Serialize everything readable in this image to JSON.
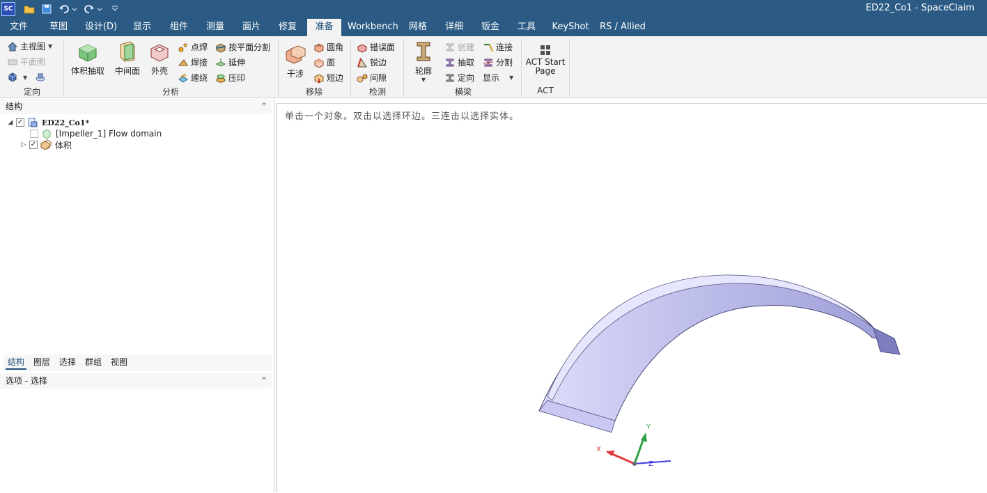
{
  "title_bar": {
    "app_badge": "SC",
    "window_title": "ED22_Co1 - SpaceClaim"
  },
  "tabs": [
    {
      "label": "文件"
    },
    {
      "label": "草图"
    },
    {
      "label": "设计(D)"
    },
    {
      "label": "显示"
    },
    {
      "label": "组件"
    },
    {
      "label": "测量"
    },
    {
      "label": "面片"
    },
    {
      "label": "修复"
    },
    {
      "label": "准备"
    },
    {
      "label": "Workbench"
    },
    {
      "label": "网格"
    },
    {
      "label": "详细"
    },
    {
      "label": "钣金"
    },
    {
      "label": "工具"
    },
    {
      "label": "KeyShot"
    },
    {
      "label": "RS / Allied"
    }
  ],
  "active_tab": "准备",
  "ribbon": {
    "orient": {
      "label": "定向",
      "home_view": "主视图",
      "plane_view": "平面图"
    },
    "analysis": {
      "label": "分析",
      "volume_extract": "体积抽取",
      "midsurface": "中间面",
      "shell": "外壳",
      "spot_weld": "点焊",
      "weld": "焊接",
      "wrap": "缠绕",
      "split_by_plane": "按平面分割",
      "extend": "延伸",
      "imprint": "压印"
    },
    "remove": {
      "label": "移除",
      "interference": "干涉",
      "rounds": "圆角",
      "faces": "面",
      "short_edges": "短边"
    },
    "detect": {
      "label": "检测",
      "problem_faces": "错误面",
      "sharp_edges": "锐边",
      "gaps": "间隙"
    },
    "beams": {
      "label": "横梁",
      "profile": "轮廓",
      "create": "创建",
      "extract": "抽取",
      "orient": "定向",
      "connect": "连接",
      "split": "分割",
      "display": "显示"
    },
    "act": {
      "label": "ACT",
      "start_page": "ACT Start Page"
    }
  },
  "structure_panel": {
    "title": "结构",
    "tree": [
      {
        "label": "ED22_Co1*",
        "checked": true
      },
      {
        "label": "[Impeller_1] Flow domain",
        "checked": false
      },
      {
        "label": "体积",
        "checked": true
      }
    ],
    "tabs": [
      {
        "label": "结构"
      },
      {
        "label": "图层"
      },
      {
        "label": "选择"
      },
      {
        "label": "群组"
      },
      {
        "label": "视图"
      }
    ]
  },
  "options_panel": {
    "title": "选项 - 选择"
  },
  "viewport": {
    "hint": "单击一个对象。双击以选择环边。三连击以选择实体。",
    "triad": {
      "x": "X",
      "y": "Y",
      "z": "Z"
    }
  },
  "colors": {
    "titlebar": "#2b5b84",
    "ribbon": "#f3f3f3",
    "body_fill": "#c8c8f2",
    "axis_x": "#e03a3a",
    "axis_y": "#2ea043",
    "axis_z": "#3a3ae0"
  },
  "icons": [
    "save-icon",
    "open-folder-icon",
    "undo-icon",
    "redo-icon",
    "pin-icon",
    "checkbox-icon",
    "component-icon",
    "body-icon"
  ]
}
